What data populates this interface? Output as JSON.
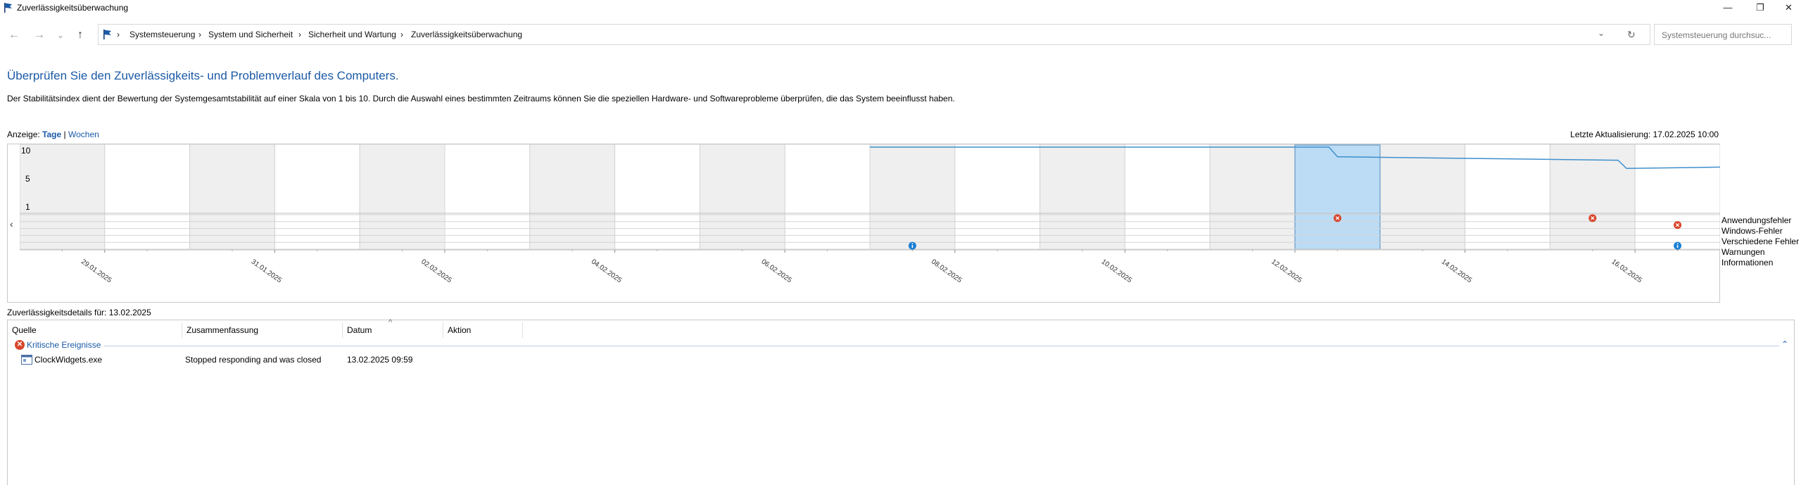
{
  "window": {
    "title": "Zuverlässigkeitsüberwachung",
    "minimize_label": "—",
    "maximize_label": "❐",
    "close_label": "✕"
  },
  "nav": {
    "back_label": "←",
    "forward_label": "→",
    "history_label": "⌄",
    "up_label": "↑",
    "dropdown_label": "⌄",
    "refresh_label": "↻"
  },
  "address": {
    "breadcrumb": [
      "Systemsteuerung",
      "System und Sicherheit",
      "Sicherheit und Wartung",
      "Zuverlässigkeitsüberwachung"
    ],
    "separator": "›"
  },
  "search": {
    "placeholder": "Systemsteuerung durchsuc..."
  },
  "page": {
    "headline": "Überprüfen Sie den Zuverlässigkeits- und Problemverlauf des Computers.",
    "description": "Der Stabilitätsindex dient der Bewertung der Systemgesamtstabilität auf einer Skala von 1 bis 10. Durch die Auswahl eines bestimmten Zeitraums können Sie die speziellen Hardware- und Softwareprobleme überprüfen, die das System beeinflusst haben.",
    "view_label": "Anzeige:",
    "view_days": "Tage",
    "view_sep": "|",
    "view_weeks": "Wochen",
    "last_update": "Letzte Aktualisierung: 17.02.2025 10:00"
  },
  "chart_data": {
    "type": "line",
    "y_ticks": [
      "10",
      "5",
      "1"
    ],
    "ylim": [
      1,
      10
    ],
    "x_labels": [
      "29.01.2025",
      "31.01.2025",
      "02.02.2025",
      "04.02.2025",
      "06.02.2025",
      "08.02.2025",
      "10.02.2025",
      "12.02.2025",
      "14.02.2025",
      "16.02.2025"
    ],
    "days_count": 20,
    "selected_day_index": 15,
    "stability_index": [
      {
        "day": 10,
        "value": 10.0
      },
      {
        "day": 15.4,
        "value": 10.0
      },
      {
        "day": 15.5,
        "value": 8.6
      },
      {
        "day": 18.8,
        "value": 8.1
      },
      {
        "day": 18.9,
        "value": 6.9
      },
      {
        "day": 20,
        "value": 7.1
      }
    ],
    "row_labels": [
      "Anwendungsfehler",
      "Windows-Fehler",
      "Verschiedene Fehler",
      "Warnungen",
      "Informationen"
    ],
    "events": [
      {
        "day": 15,
        "row": 0,
        "kind": "error"
      },
      {
        "day": 18,
        "row": 0,
        "kind": "error"
      },
      {
        "day": 19,
        "row": 1,
        "kind": "error"
      },
      {
        "day": 10,
        "row": 4,
        "kind": "info"
      },
      {
        "day": 19,
        "row": 4,
        "kind": "info"
      }
    ],
    "scroll_left": "‹",
    "scroll_right": "›"
  },
  "details": {
    "title": "Zuverlässigkeitsdetails für: 13.02.2025",
    "columns": [
      "Quelle",
      "Zusammenfassung",
      "Datum",
      "Aktion"
    ],
    "sort_indicator": "^",
    "group": "Kritische Ereignisse",
    "collapse_label": "⌃",
    "rows": [
      {
        "source": "ClockWidgets.exe",
        "summary": "Stopped responding and was closed",
        "date": "13.02.2025 09:59",
        "action": ""
      }
    ]
  }
}
